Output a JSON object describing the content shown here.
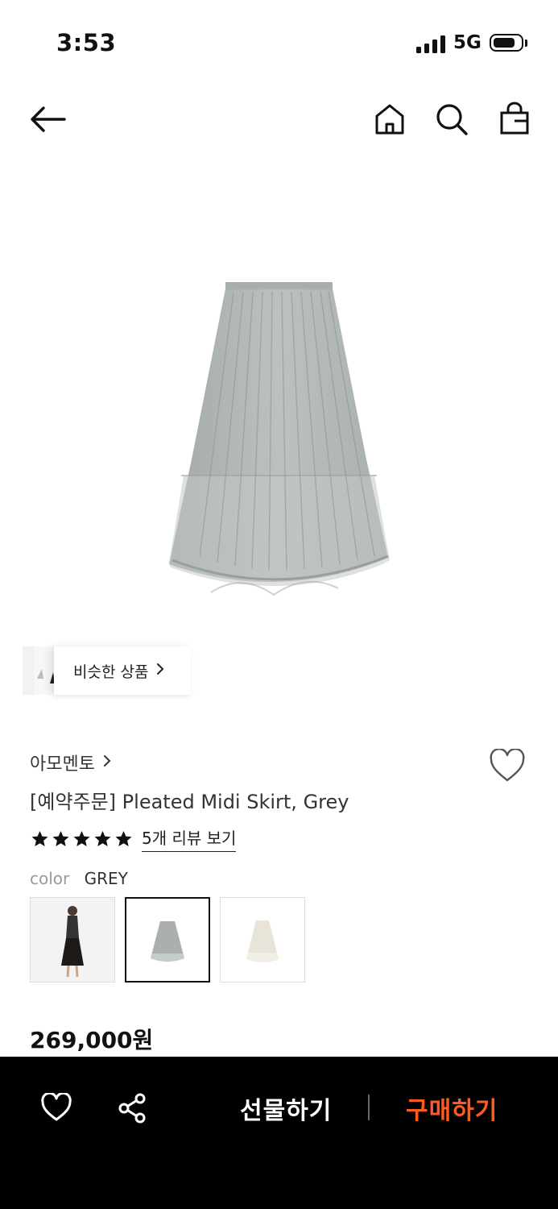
{
  "status_bar": {
    "time": "3:53",
    "network": "5G",
    "battery_level": 0.7
  },
  "nav": {
    "back_icon": "arrow-left-icon",
    "home_icon": "home-icon",
    "search_icon": "search-icon",
    "bag_icon": "shopping-bag-icon"
  },
  "product": {
    "image_icon": "pleated-skirt-image",
    "similar_label": "비슷한 상품",
    "brand": "아모멘토",
    "title": "[예약주문] Pleated Midi Skirt, Grey",
    "rating_stars": 5,
    "review_link": "5개 리뷰 보기",
    "color_label": "color",
    "color_value": "GREY",
    "swatches": [
      "model-black-skirt",
      "grey-skirt",
      "ivory-skirt"
    ],
    "selected_swatch": 1,
    "price": "269,000원"
  },
  "bottom_bar": {
    "wishlist_icon": "heart-icon",
    "share_icon": "share-icon",
    "gift_label": "선물하기",
    "buy_label": "구매하기",
    "buy_color": "#ff5a1f"
  }
}
